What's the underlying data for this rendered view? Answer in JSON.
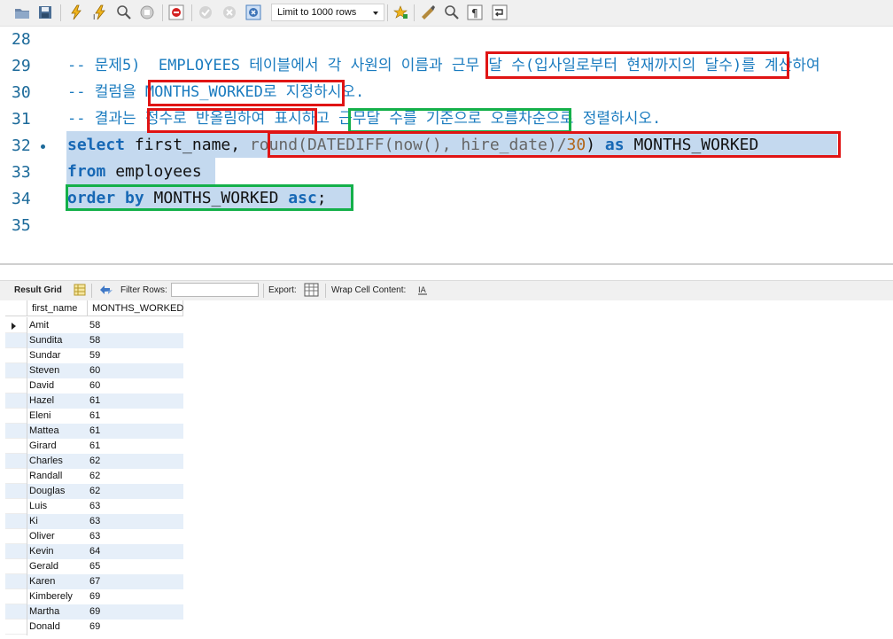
{
  "toolbar": {
    "limit_label": "Limit to 1000 rows",
    "icons": [
      "open-folder-icon",
      "save-icon",
      "execute-icon",
      "execute-current-icon",
      "explain-icon",
      "stop-icon",
      "toggle-error-icon",
      "commit-icon",
      "rollback-icon",
      "autocommit-icon",
      "beautify-icon",
      "find-icon",
      "invisible-chars-icon",
      "wrap-icon"
    ]
  },
  "editor": {
    "lines": [
      {
        "num": "28"
      },
      {
        "num": "29",
        "comment": "-- 문제5)  EMPLOYEES 테이블에서 각 사원의 이름과 근무 달 수(입사일로부터 현재까지의 달수)를 계산하여"
      },
      {
        "num": "30",
        "comment": "-- 컬럼을 MONTHS_WORKED로 지정하시오."
      },
      {
        "num": "31",
        "comment": "-- 결과는 정수로 반올림하여 표시하고 근무달 수를 기준으로 오름차순으로 정렬하시오."
      },
      {
        "num": "32"
      },
      {
        "num": "33"
      },
      {
        "num": "34"
      },
      {
        "num": "35"
      }
    ],
    "code32": {
      "kw1": "select",
      "t1": " first_name, ",
      "fn1": "round(DATEDIFF(now(), hire_date)/",
      "num": "30",
      "t2": ") ",
      "kw2": "as",
      "t3": " MONTHS_WORKED"
    },
    "code33": {
      "kw1": "from",
      "t1": " employees"
    },
    "code34": {
      "kw1": "order by",
      "t1": " MONTHS_WORKED ",
      "kw2": "asc",
      "t2": ";"
    }
  },
  "result_toolbar": {
    "result_grid": "Result Grid",
    "filter_rows": "Filter Rows:",
    "export": "Export:",
    "wrap": "Wrap Cell Content:"
  },
  "grid": {
    "columns": [
      "first_name",
      "MONTHS_WORKED"
    ],
    "rows": [
      [
        "Amit",
        "58"
      ],
      [
        "Sundita",
        "58"
      ],
      [
        "Sundar",
        "59"
      ],
      [
        "Steven",
        "60"
      ],
      [
        "David",
        "60"
      ],
      [
        "Hazel",
        "61"
      ],
      [
        "Eleni",
        "61"
      ],
      [
        "Mattea",
        "61"
      ],
      [
        "Girard",
        "61"
      ],
      [
        "Charles",
        "62"
      ],
      [
        "Randall",
        "62"
      ],
      [
        "Douglas",
        "62"
      ],
      [
        "Luis",
        "63"
      ],
      [
        "Ki",
        "63"
      ],
      [
        "Oliver",
        "63"
      ],
      [
        "Kevin",
        "64"
      ],
      [
        "Gerald",
        "65"
      ],
      [
        "Karen",
        "67"
      ],
      [
        "Kimberely",
        "69"
      ],
      [
        "Martha",
        "69"
      ],
      [
        "Donald",
        "69"
      ]
    ]
  },
  "colors": {
    "highlight_red": "#e01414",
    "highlight_green": "#14b04a",
    "selection": "#c4d9ef",
    "keyword": "#1768b5",
    "comment": "#1a7bbf"
  }
}
